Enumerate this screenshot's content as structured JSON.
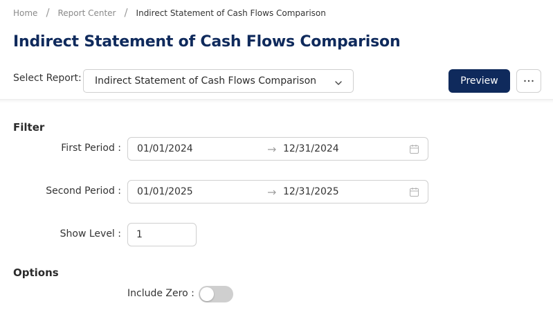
{
  "breadcrumb": {
    "items": [
      "Home",
      "Report Center",
      "Indirect Statement of Cash Flows Comparison"
    ],
    "separator": "/"
  },
  "page_title": "Indirect Statement of Cash Flows Comparison",
  "report_select": {
    "label": "Select Report:",
    "value": "Indirect Statement of Cash Flows Comparison"
  },
  "toolbar": {
    "preview_label": "Preview",
    "more_icon": "ellipsis-icon"
  },
  "filter": {
    "title": "Filter",
    "first_period": {
      "label": "First Period :",
      "start": "01/01/2024",
      "end": "12/31/2024"
    },
    "second_period": {
      "label": "Second Period :",
      "start": "01/01/2025",
      "end": "12/31/2025"
    },
    "show_level": {
      "label": "Show Level :",
      "value": "1"
    }
  },
  "options": {
    "title": "Options",
    "include_zero": {
      "label": "Include Zero :",
      "enabled": false
    }
  },
  "colors": {
    "primary": "#0f2a5c",
    "border": "#cfcfcf",
    "toggle_off": "#cfcfcf"
  }
}
